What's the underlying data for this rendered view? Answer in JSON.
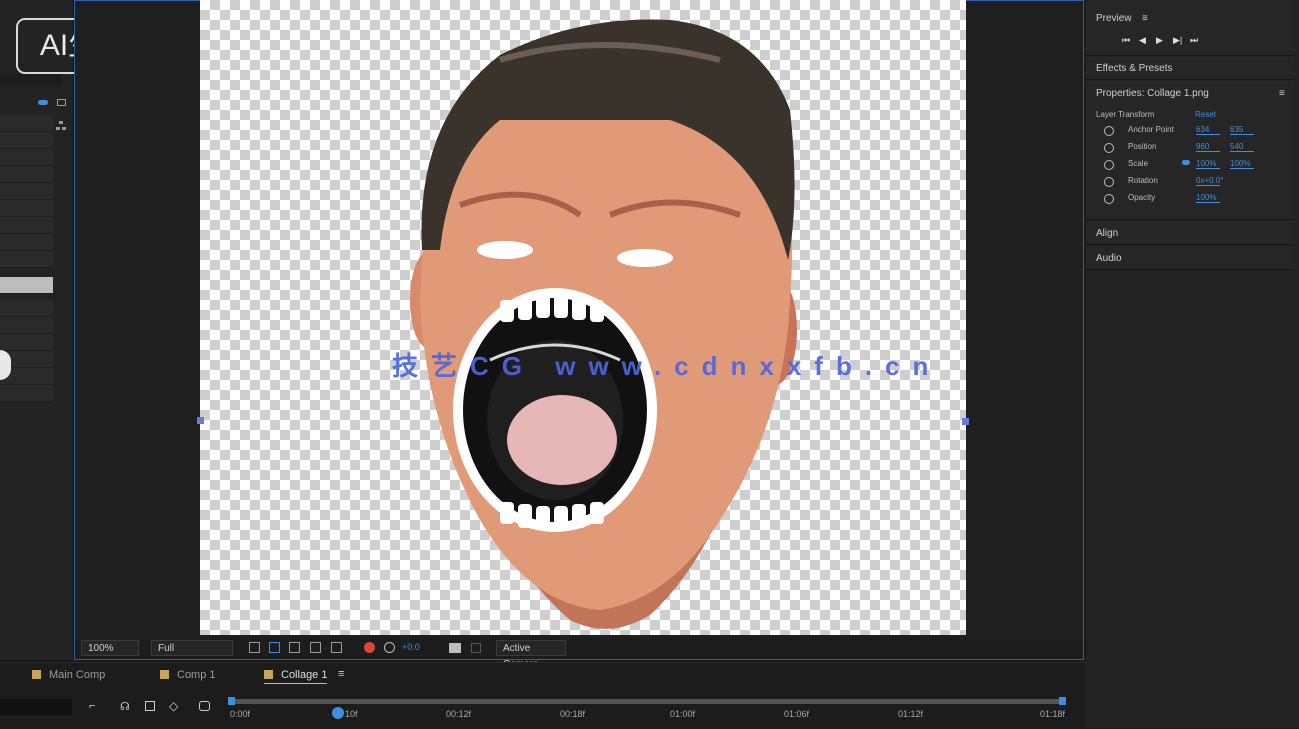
{
  "badge": {
    "label": "AI生成"
  },
  "watermark": {
    "text": "技艺CG www.cdnxxfb.cn"
  },
  "viewer": {
    "zoom_value": "100%",
    "resolution_value": "Full",
    "exposure_value": "+0.0",
    "camera_value": "Active Camera"
  },
  "right_panel": {
    "preview": {
      "title": "Preview"
    },
    "effects": {
      "title": "Effects & Presets"
    },
    "properties": {
      "title": "Properties: Collage 1.png",
      "subheader_left": "Layer Transform",
      "subheader_right": "Reset",
      "rows": [
        {
          "label": "Anchor Point",
          "v1": "634",
          "v2": "635"
        },
        {
          "label": "Position",
          "v1": "960",
          "v2": "540"
        },
        {
          "label": "Scale",
          "v1": "100%",
          "v2": "100%"
        },
        {
          "label": "Rotation",
          "v1": "0x+0.0°",
          "v2": ""
        },
        {
          "label": "Opacity",
          "v1": "100%",
          "v2": ""
        }
      ]
    },
    "align": {
      "title": "Align"
    },
    "audio": {
      "title": "Audio"
    }
  },
  "timeline": {
    "tabs": [
      {
        "label": "Main Comp"
      },
      {
        "label": "Comp 1"
      },
      {
        "label": "Collage 1"
      }
    ],
    "ticks": [
      "0:00f",
      "10f",
      "00:12f",
      "00:18f",
      "01:00f",
      "01:06f",
      "01:12f",
      "01:18f"
    ]
  },
  "colors": {
    "accent": "#3e8ee0",
    "selection": "#2c5fa8",
    "watermark": "#4e66e0"
  },
  "icons": [
    "first-frame-icon",
    "prev-frame-icon",
    "play-icon",
    "next-frame-icon",
    "last-frame-icon",
    "panel-menu-icon",
    "stopwatch-icon",
    "link-icon"
  ]
}
